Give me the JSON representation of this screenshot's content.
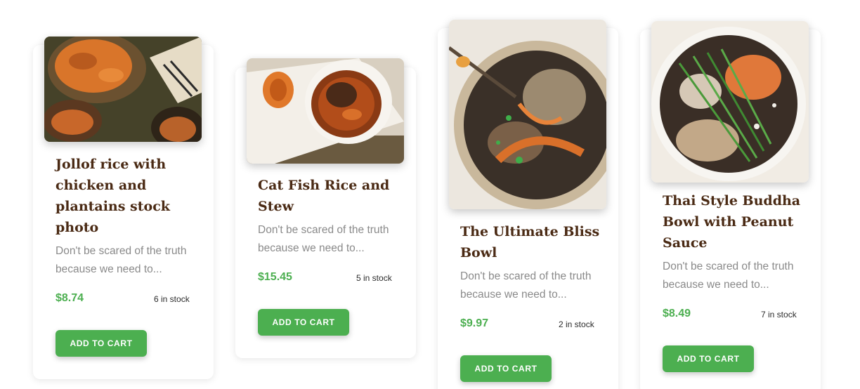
{
  "theme": {
    "accent": "#4caf50",
    "title_color": "#4a2a14",
    "text_muted": "#8a8a8a"
  },
  "products": [
    {
      "title": "Jollof rice with chicken and plantains stock photo",
      "description": "Don't be scared of the truth because we need to...",
      "price": "$8.74",
      "stock": "6 in stock",
      "button": "ADD TO CART"
    },
    {
      "title": "Cat Fish Rice and Stew",
      "description": "Don't be scared of the truth because we need to...",
      "price": "$15.45",
      "stock": "5 in stock",
      "button": "ADD TO CART"
    },
    {
      "title": "The Ultimate Bliss Bowl",
      "description": "Don't be scared of the truth because we need to...",
      "price": "$9.97",
      "stock": "2 in stock",
      "button": "ADD TO CART"
    },
    {
      "title": "Thai Style Buddha Bowl with Peanut Sauce",
      "description": "Don't be scared of the truth because we need to...",
      "price": "$8.49",
      "stock": "7 in stock",
      "button": "ADD TO CART"
    }
  ]
}
